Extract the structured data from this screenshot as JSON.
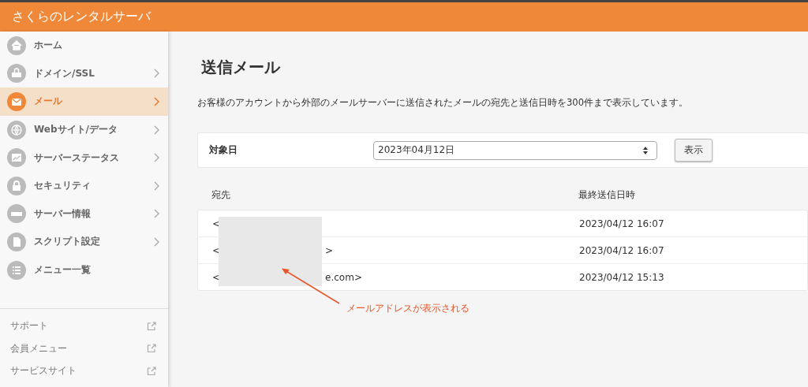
{
  "header": {
    "title": "さくらのレンタルサーバ"
  },
  "sidebar": {
    "items": [
      {
        "label": "ホーム",
        "kind": "link",
        "selected": false
      },
      {
        "label": "ドメイン/SSL",
        "kind": "submenu",
        "selected": false
      },
      {
        "label": "メール",
        "kind": "submenu",
        "selected": true
      },
      {
        "label": "Webサイト/データ",
        "kind": "submenu",
        "selected": false
      },
      {
        "label": "サーバーステータス",
        "kind": "submenu",
        "selected": false
      },
      {
        "label": "セキュリティ",
        "kind": "submenu",
        "selected": false
      },
      {
        "label": "サーバー情報",
        "kind": "submenu",
        "selected": false
      },
      {
        "label": "スクリプト設定",
        "kind": "submenu",
        "selected": false
      },
      {
        "label": "メニュー一覧",
        "kind": "link",
        "selected": false
      }
    ],
    "links": [
      {
        "label": "サポート"
      },
      {
        "label": "会員メニュー"
      },
      {
        "label": "サービスサイト"
      }
    ]
  },
  "main": {
    "title": "送信メール",
    "description": "お客様のアカウントから外部のメールサーバーに送信されたメールの宛先と送信日時を300件まで表示しています。",
    "filter": {
      "label": "対象日",
      "value": "2023年04月12日",
      "button": "表示"
    },
    "table": {
      "columns": [
        "宛先",
        "最終送信日時"
      ],
      "rows": [
        {
          "address_start": "<",
          "address_end": "",
          "sent": "2023/04/12 16:07"
        },
        {
          "address_start": "<",
          "address_end": ">",
          "sent": "2023/04/12 16:07"
        },
        {
          "address_start": "<",
          "address_end": "e.com>",
          "sent": "2023/04/12 15:13"
        }
      ]
    },
    "annotation": {
      "text": "メールアドレスが表示される"
    }
  }
}
